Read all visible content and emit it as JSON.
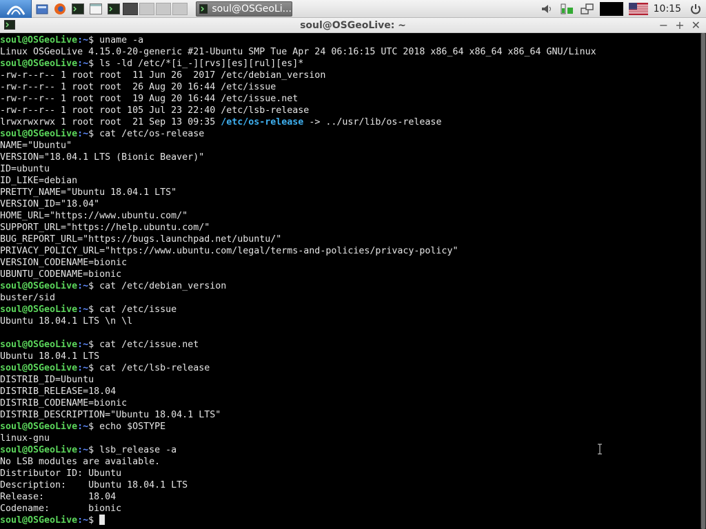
{
  "taskbar": {
    "task_title": "soul@OSGeoLi...",
    "clock": "10:15",
    "icons": [
      "start-menu-icon",
      "file-manager-icon",
      "firefox-icon",
      "terminal-icon",
      "window-icon",
      "terminal-icon",
      "volume-icon",
      "battery-icon",
      "network-icon",
      "us-flag-icon",
      "power-icon"
    ]
  },
  "window": {
    "title": "soul@OSGeoLive: ~",
    "minimize": "−",
    "maximize": "+",
    "close": "✕"
  },
  "terminal": {
    "prompt_user": "soul@OSGeoLive",
    "prompt_path": ":~",
    "prompt_sign": "$ ",
    "lines": [
      {
        "t": "prompt",
        "cmd": "uname -a"
      },
      {
        "t": "out",
        "text": "Linux OSGeoLive 4.15.0-20-generic #21-Ubuntu SMP Tue Apr 24 06:16:15 UTC 2018 x86_64 x86_64 x86_64 GNU/Linux"
      },
      {
        "t": "prompt",
        "cmd": "ls -ld /etc/*[i_-][rvs][es][rul][es]*"
      },
      {
        "t": "out",
        "text": "-rw-r--r-- 1 root root  11 Jun 26  2017 /etc/debian_version"
      },
      {
        "t": "out",
        "text": "-rw-r--r-- 1 root root  26 Aug 20 16:44 /etc/issue"
      },
      {
        "t": "out",
        "text": "-rw-r--r-- 1 root root  19 Aug 20 16:44 /etc/issue.net"
      },
      {
        "t": "out",
        "text": "-rw-r--r-- 1 root root 105 Jul 23 22:40 /etc/lsb-release"
      },
      {
        "t": "link",
        "pre": "lrwxrwxrwx 1 root root  21 Sep 13 09:35 ",
        "hl": "/etc/os-release",
        "post": " -> ../usr/lib/os-release"
      },
      {
        "t": "prompt",
        "cmd": "cat /etc/os-release"
      },
      {
        "t": "out",
        "text": "NAME=\"Ubuntu\""
      },
      {
        "t": "out",
        "text": "VERSION=\"18.04.1 LTS (Bionic Beaver)\""
      },
      {
        "t": "out",
        "text": "ID=ubuntu"
      },
      {
        "t": "out",
        "text": "ID_LIKE=debian"
      },
      {
        "t": "out",
        "text": "PRETTY_NAME=\"Ubuntu 18.04.1 LTS\""
      },
      {
        "t": "out",
        "text": "VERSION_ID=\"18.04\""
      },
      {
        "t": "out",
        "text": "HOME_URL=\"https://www.ubuntu.com/\""
      },
      {
        "t": "out",
        "text": "SUPPORT_URL=\"https://help.ubuntu.com/\""
      },
      {
        "t": "out",
        "text": "BUG_REPORT_URL=\"https://bugs.launchpad.net/ubuntu/\""
      },
      {
        "t": "out",
        "text": "PRIVACY_POLICY_URL=\"https://www.ubuntu.com/legal/terms-and-policies/privacy-policy\""
      },
      {
        "t": "out",
        "text": "VERSION_CODENAME=bionic"
      },
      {
        "t": "out",
        "text": "UBUNTU_CODENAME=bionic"
      },
      {
        "t": "prompt",
        "cmd": "cat /etc/debian_version"
      },
      {
        "t": "out",
        "text": "buster/sid"
      },
      {
        "t": "prompt",
        "cmd": "cat /etc/issue"
      },
      {
        "t": "out",
        "text": "Ubuntu 18.04.1 LTS \\n \\l"
      },
      {
        "t": "out",
        "text": ""
      },
      {
        "t": "prompt",
        "cmd": "cat /etc/issue.net"
      },
      {
        "t": "out",
        "text": "Ubuntu 18.04.1 LTS"
      },
      {
        "t": "prompt",
        "cmd": "cat /etc/lsb-release"
      },
      {
        "t": "out",
        "text": "DISTRIB_ID=Ubuntu"
      },
      {
        "t": "out",
        "text": "DISTRIB_RELEASE=18.04"
      },
      {
        "t": "out",
        "text": "DISTRIB_CODENAME=bionic"
      },
      {
        "t": "out",
        "text": "DISTRIB_DESCRIPTION=\"Ubuntu 18.04.1 LTS\""
      },
      {
        "t": "prompt",
        "cmd": "echo $OSTYPE"
      },
      {
        "t": "out",
        "text": "linux-gnu"
      },
      {
        "t": "prompt",
        "cmd": "lsb_release -a"
      },
      {
        "t": "out",
        "text": "No LSB modules are available."
      },
      {
        "t": "out",
        "text": "Distributor ID: Ubuntu"
      },
      {
        "t": "out",
        "text": "Description:    Ubuntu 18.04.1 LTS"
      },
      {
        "t": "out",
        "text": "Release:        18.04"
      },
      {
        "t": "out",
        "text": "Codename:       bionic"
      },
      {
        "t": "prompt",
        "cmd": "",
        "cursor": true
      }
    ]
  },
  "colors": {
    "prompt_user": "#5bd65b",
    "prompt_path": "#5f8cff",
    "link": "#3fb0f0",
    "text": "#e6e6e6",
    "background": "#000000"
  }
}
